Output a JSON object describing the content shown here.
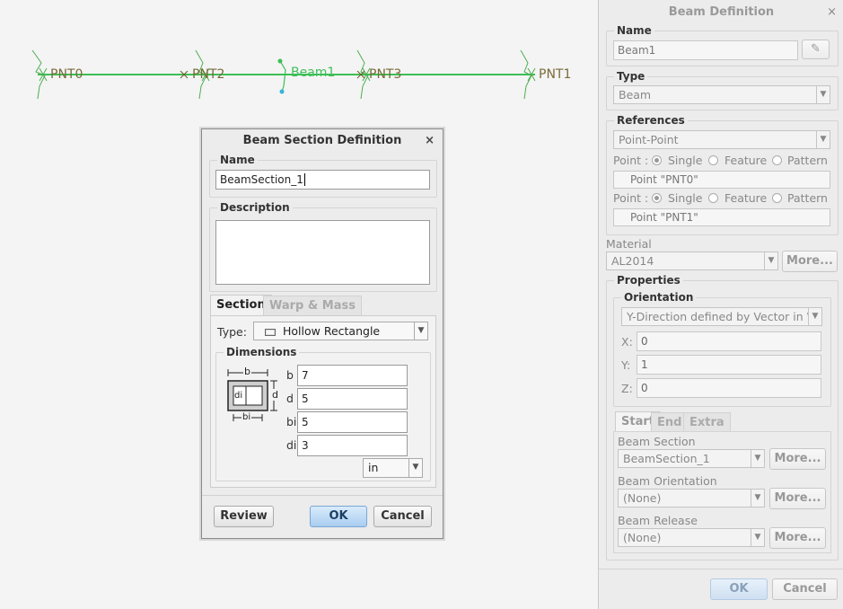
{
  "canvas": {
    "points": [
      "PNT0",
      "PNT2",
      "PNT3",
      "PNT1"
    ],
    "beam_label": "Beam1"
  },
  "beam_definition": {
    "title": "Beam Definition",
    "close": "×",
    "name_group": "Name",
    "name_value": "Beam1",
    "type_group": "Type",
    "type_value": "Beam",
    "references_group": "References",
    "references_value": "Point-Point",
    "point_label": "Point :",
    "radio_options": [
      "Single",
      "Feature",
      "Pattern"
    ],
    "point1_value": "Point \"PNT0\"",
    "point2_value": "Point \"PNT1\"",
    "material_label": "Material",
    "material_value": "AL2014",
    "more_label": "More...",
    "properties_group": "Properties",
    "orientation_group": "Orientation",
    "orientation_value": "Y-Direction defined by Vector in W",
    "x_label": "X:",
    "x_value": "0",
    "y_label": "Y:",
    "y_value": "1",
    "z_label": "Z:",
    "z_value": "0",
    "tabs": [
      "Start",
      "End",
      "Extra"
    ],
    "beam_section_label": "Beam Section",
    "beam_section_value": "BeamSection_1",
    "beam_orientation_label": "Beam Orientation",
    "beam_orientation_value": "(None)",
    "beam_release_label": "Beam Release",
    "beam_release_value": "(None)",
    "ok_label": "OK",
    "cancel_label": "Cancel"
  },
  "section_dialog": {
    "title": "Beam Section Definition",
    "close": "×",
    "name_group": "Name",
    "name_value": "BeamSection_1",
    "description_group": "Description",
    "description_value": "",
    "tabs": [
      "Section",
      "Warp & Mass"
    ],
    "type_label": "Type:",
    "type_value": "Hollow Rectangle",
    "dimensions_group": "Dimensions",
    "diagram_labels": {
      "b": "b",
      "d": "d",
      "bi": "bi",
      "di": "di"
    },
    "dims": [
      {
        "label": "b",
        "value": "7"
      },
      {
        "label": "d",
        "value": "5"
      },
      {
        "label": "bi",
        "value": "5"
      },
      {
        "label": "di",
        "value": "3"
      }
    ],
    "units_value": "in",
    "review_label": "Review",
    "ok_label": "OK",
    "cancel_label": "Cancel"
  },
  "colors": {
    "beam_line": "#3cbf55",
    "point_marker": "#4caf50",
    "point_label": "#7a6a3a",
    "dialog_bg": "#ececec"
  }
}
